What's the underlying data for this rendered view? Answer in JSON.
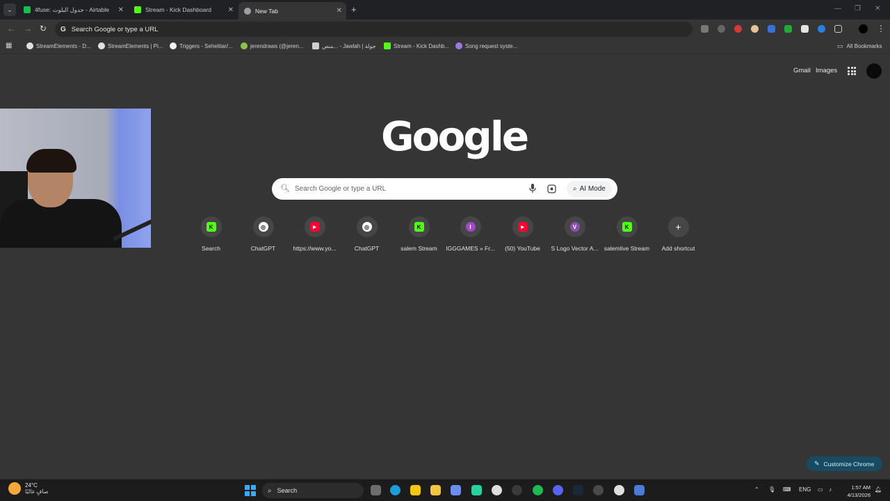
{
  "tabs": [
    {
      "title": "4fuse: جدول البلوت - Airtable",
      "active": false,
      "color": "#18bf4b"
    },
    {
      "title": "Stream - Kick Dashboard",
      "active": false,
      "color": "#53fc18"
    },
    {
      "title": "New Tab",
      "active": true,
      "color": "#9aa0a6"
    }
  ],
  "omnibox": {
    "placeholder": "Search Google or type a URL"
  },
  "bookmarks": [
    {
      "label": "StreamElements - D...",
      "icon": "streamelements-icon"
    },
    {
      "label": "StreamElements | Pi...",
      "icon": "streamelements-icon"
    },
    {
      "label": "Triggers - Sehelitar/...",
      "icon": "github-icon"
    },
    {
      "label": "jerendraws (@jeren...",
      "icon": "avatar-icon"
    },
    {
      "label": "منص... - Jawlah | جولة",
      "icon": "jawlah-icon"
    },
    {
      "label": "Stream - Kick Dashb...",
      "icon": "kick-icon"
    },
    {
      "label": "Song request syste...",
      "icon": "song-request-icon"
    }
  ],
  "all_bookmarks": "All Bookmarks",
  "header_links": {
    "gmail": "Gmail",
    "images": "Images"
  },
  "logo_text": "Google",
  "search": {
    "placeholder": "Search Google or type a URL",
    "ai_mode": "AI Mode"
  },
  "shortcuts": [
    {
      "label": "Search",
      "icon": "kick-icon",
      "color": "#53fc18",
      "glyph": "K"
    },
    {
      "label": "ChatGPT",
      "icon": "chatgpt-icon",
      "color": "#ffffff",
      "glyph": "◎"
    },
    {
      "label": "https://www.yo...",
      "icon": "youtube-icon",
      "color": "#ff0033",
      "glyph": "▶"
    },
    {
      "label": "ChatGPT",
      "icon": "chatgpt-icon",
      "color": "#ffffff",
      "glyph": "◎"
    },
    {
      "label": "salem Stream",
      "icon": "kick-icon",
      "color": "#53fc18",
      "glyph": "K"
    },
    {
      "label": "IGGGAMES » Fr...",
      "icon": "letter-i-icon",
      "color": "#a646c9",
      "glyph": "I"
    },
    {
      "label": "(50) YouTube",
      "icon": "youtube-icon",
      "color": "#ff0033",
      "glyph": "▶"
    },
    {
      "label": "S Logo Vector A...",
      "icon": "letter-v-icon",
      "color": "#8a4fb0",
      "glyph": "V"
    },
    {
      "label": "salemlive Stream",
      "icon": "kick-icon",
      "color": "#53fc18",
      "glyph": "K"
    },
    {
      "label": "Add shortcut",
      "icon": "plus-icon",
      "color": "#464646",
      "glyph": "+"
    }
  ],
  "customize": "Customize Chrome",
  "taskbar": {
    "temperature": "24°C",
    "condition": "صافٍ غالبًا",
    "search": "Search",
    "language": "ENG",
    "time": "1:57 AM",
    "date": "4/13/2026"
  }
}
